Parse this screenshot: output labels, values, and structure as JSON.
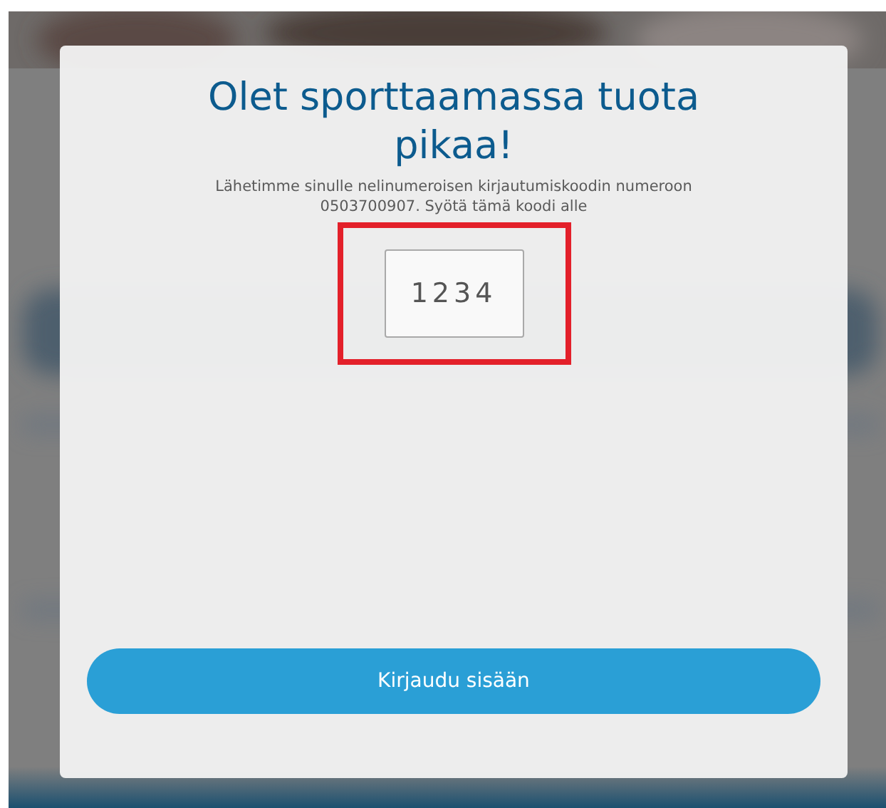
{
  "dialog": {
    "title": "Olet sporttaamassa tuota pikaa!",
    "message": "Lähetimme sinulle nelinumeroisen kirjautumiskoodin numeroon 0503700907. Syötä tämä koodi alle",
    "code_field": {
      "value": "1234",
      "highlighted": true
    },
    "submit_button": {
      "label": "Kirjaudu sisään"
    }
  }
}
